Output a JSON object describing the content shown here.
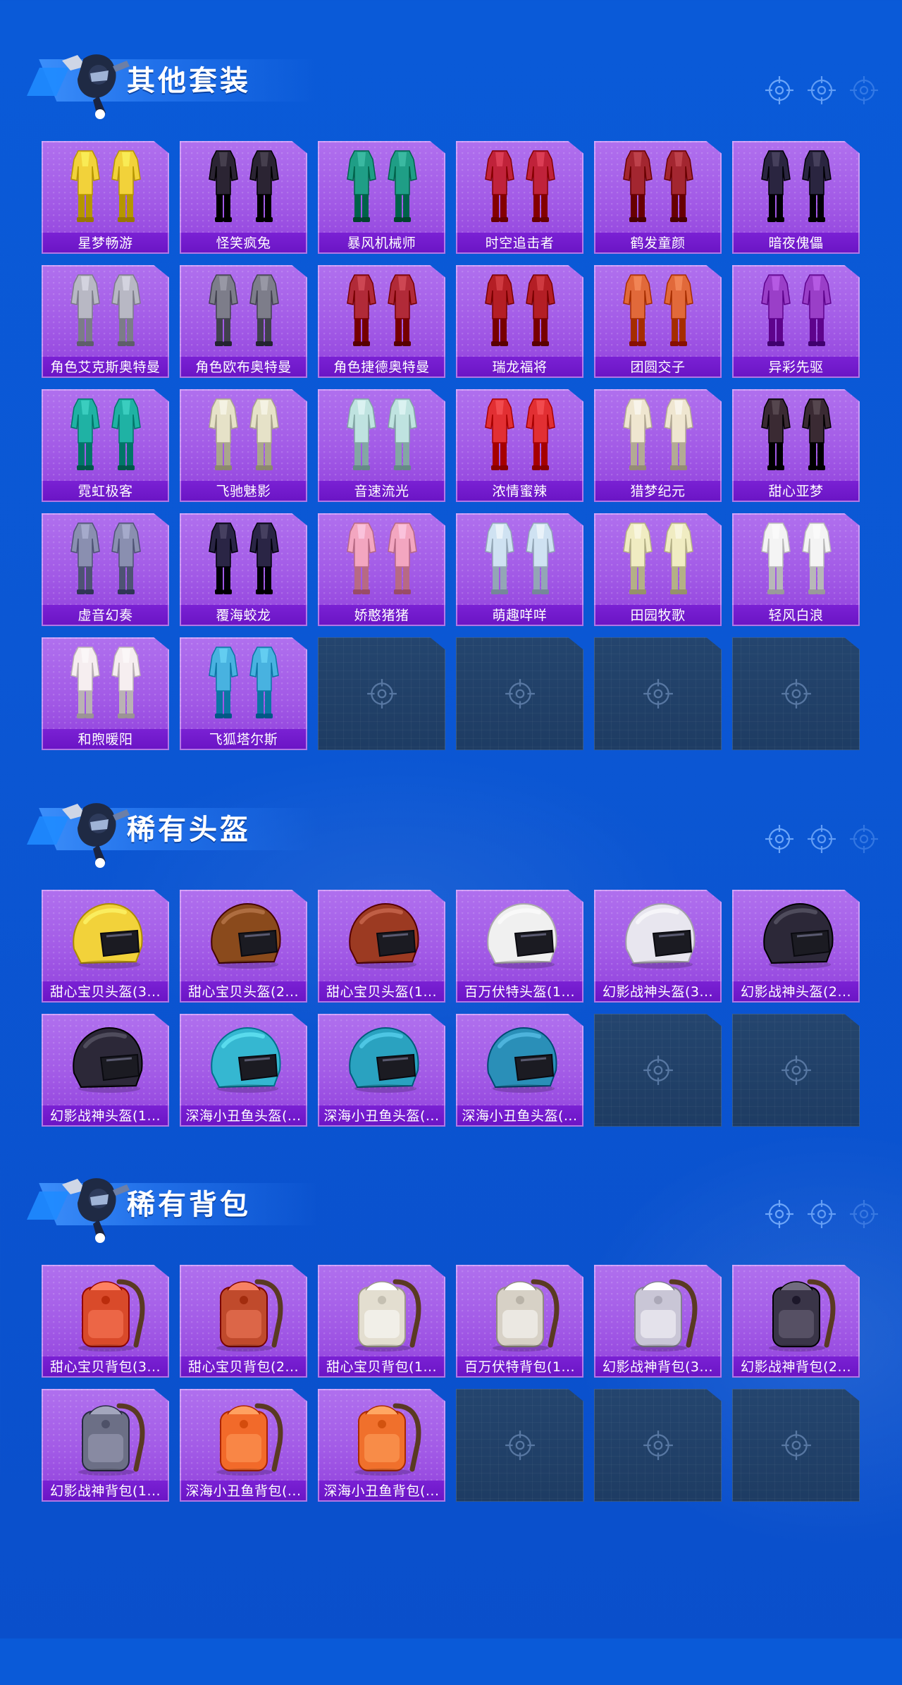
{
  "sections": [
    {
      "title": "其他套装",
      "kind": "suit",
      "items": [
        {
          "label": "星梦畅游",
          "color": "#f2d23a",
          "icon": "outfit-icon"
        },
        {
          "label": "怪笑疯兔",
          "color": "#2b2433",
          "icon": "outfit-icon"
        },
        {
          "label": "暴风机械师",
          "color": "#1f9e86",
          "icon": "outfit-icon"
        },
        {
          "label": "时空追击者",
          "color": "#c0223a",
          "icon": "outfit-icon"
        },
        {
          "label": "鹤发童颜",
          "color": "#a32630",
          "icon": "outfit-icon"
        },
        {
          "label": "暗夜傀儡",
          "color": "#2a2540",
          "icon": "outfit-icon"
        },
        {
          "label": "角色艾克斯奥特曼",
          "color": "#b8b8c4",
          "icon": "outfit-icon"
        },
        {
          "label": "角色欧布奥特曼",
          "color": "#7d7d8a",
          "icon": "outfit-icon"
        },
        {
          "label": "角色捷德奥特曼",
          "color": "#b12a38",
          "icon": "outfit-icon"
        },
        {
          "label": "瑞龙福将",
          "color": "#b41e25",
          "icon": "outfit-icon"
        },
        {
          "label": "团圆交子",
          "color": "#e1693a",
          "icon": "outfit-icon"
        },
        {
          "label": "异彩先驱",
          "color": "#9a3fc8",
          "icon": "outfit-icon"
        },
        {
          "label": "霓虹极客",
          "color": "#1fb2a4",
          "icon": "outfit-icon"
        },
        {
          "label": "飞驰魅影",
          "color": "#e6e2c8",
          "icon": "outfit-icon"
        },
        {
          "label": "音速流光",
          "color": "#bfe3e0",
          "icon": "outfit-icon"
        },
        {
          "label": "浓情蜜辣",
          "color": "#e22f33",
          "icon": "outfit-icon"
        },
        {
          "label": "猎梦纪元",
          "color": "#efe6d0",
          "icon": "outfit-icon"
        },
        {
          "label": "甜心亚梦",
          "color": "#3a2a33",
          "icon": "outfit-icon"
        },
        {
          "label": "虚音幻奏",
          "color": "#8a8fb0",
          "icon": "outfit-icon"
        },
        {
          "label": "覆海蛟龙",
          "color": "#2a2545",
          "icon": "outfit-icon"
        },
        {
          "label": "娇憨猪猪",
          "color": "#f3a6c0",
          "icon": "outfit-icon"
        },
        {
          "label": "萌趣咩咩",
          "color": "#cfe2f2",
          "icon": "outfit-icon"
        },
        {
          "label": "田园牧歌",
          "color": "#f0ecc2",
          "icon": "outfit-icon"
        },
        {
          "label": "轻风白浪",
          "color": "#f4f4f4",
          "icon": "outfit-icon"
        },
        {
          "label": "和煦暖阳",
          "color": "#f6eef0",
          "icon": "outfit-icon"
        },
        {
          "label": "飞狐塔尔斯",
          "color": "#48b2e0",
          "icon": "outfit-icon"
        }
      ],
      "empty_slots": 4
    },
    {
      "title": "稀有头盔",
      "kind": "helmet",
      "items": [
        {
          "label": "甜心宝贝头盔(3...",
          "color": "#f2d23a",
          "icon": "helmet-icon"
        },
        {
          "label": "甜心宝贝头盔(2...",
          "color": "#8a4a1c",
          "icon": "helmet-icon"
        },
        {
          "label": "甜心宝贝头盔(1...",
          "color": "#9c3a22",
          "icon": "helmet-icon"
        },
        {
          "label": "百万伏特头盔(1...",
          "color": "#f0f0f0",
          "icon": "helmet-icon"
        },
        {
          "label": "幻影战神头盔(3...",
          "color": "#e8e6ef",
          "icon": "helmet-icon"
        },
        {
          "label": "幻影战神头盔(2...",
          "color": "#2c2838",
          "icon": "helmet-icon"
        },
        {
          "label": "幻影战神头盔(1...",
          "color": "#2c2838",
          "icon": "helmet-icon"
        },
        {
          "label": "深海小丑鱼头盔(...",
          "color": "#35b7d1",
          "icon": "helmet-icon"
        },
        {
          "label": "深海小丑鱼头盔(...",
          "color": "#2aa2c0",
          "icon": "helmet-icon"
        },
        {
          "label": "深海小丑鱼头盔(...",
          "color": "#2a8fb8",
          "icon": "helmet-icon"
        }
      ],
      "empty_slots": 2
    },
    {
      "title": "稀有背包",
      "kind": "backpack",
      "items": [
        {
          "label": "甜心宝贝背包(3...",
          "color": "#d94a2a",
          "icon": "backpack-icon"
        },
        {
          "label": "甜心宝贝背包(2...",
          "color": "#c04a2c",
          "icon": "backpack-icon"
        },
        {
          "label": "甜心宝贝背包(1...",
          "color": "#e3ded0",
          "icon": "backpack-icon"
        },
        {
          "label": "百万伏特背包(1...",
          "color": "#d7d1c6",
          "icon": "backpack-icon"
        },
        {
          "label": "幻影战神背包(3...",
          "color": "#c9c6d6",
          "icon": "backpack-icon"
        },
        {
          "label": "幻影战神背包(2...",
          "color": "#3a3548",
          "icon": "backpack-icon"
        },
        {
          "label": "幻影战神背包(1...",
          "color": "#6c6f86",
          "icon": "backpack-icon"
        },
        {
          "label": "深海小丑鱼背包(...",
          "color": "#f26a2a",
          "icon": "backpack-icon"
        },
        {
          "label": "深海小丑鱼背包(...",
          "color": "#f0702c",
          "icon": "backpack-icon"
        }
      ],
      "empty_slots": 3
    }
  ],
  "section_decoration": {
    "icons": [
      "crosshair-icon",
      "crosshair-icon",
      "crosshair-icon"
    ]
  },
  "empty_slot_icon": "crosshair-icon",
  "colors": {
    "background": "#0b57d4",
    "card": "#a25ae6",
    "label_bar": "#7a21d4",
    "empty_slot": "#22426a"
  }
}
